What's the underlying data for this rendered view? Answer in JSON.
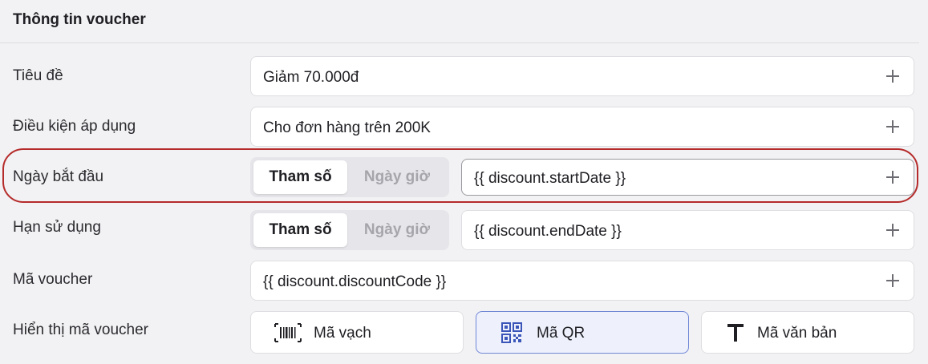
{
  "section": {
    "title": "Thông tin voucher"
  },
  "fields": {
    "title": {
      "label": "Tiêu đề",
      "value": "Giảm 70.000đ",
      "add_icon": "plus-icon"
    },
    "condition": {
      "label": "Điều kiện áp dụng",
      "value": "Cho đơn hàng trên 200K",
      "add_icon": "plus-icon"
    },
    "start_date": {
      "label": "Ngày bắt đầu",
      "toggle": {
        "active": "Tham số",
        "inactive": "Ngày giờ"
      },
      "value": "{{ discount.startDate }}",
      "add_icon": "plus-icon",
      "highlighted": true
    },
    "expiry": {
      "label": "Hạn sử dụng",
      "toggle": {
        "active": "Tham số",
        "inactive": "Ngày giờ"
      },
      "value": "{{ discount.endDate }}",
      "add_icon": "plus-icon"
    },
    "code": {
      "label": "Mã voucher",
      "value": "{{ discount.discountCode }}",
      "add_icon": "plus-icon"
    },
    "display": {
      "label": "Hiển thị mã voucher",
      "options": [
        {
          "label": "Mã vạch",
          "icon": "barcode-icon",
          "selected": false
        },
        {
          "label": "Mã QR",
          "icon": "qr-code-icon",
          "selected": true
        },
        {
          "label": "Mã văn bản",
          "icon": "text-icon",
          "selected": false
        }
      ]
    }
  },
  "colors": {
    "background": "#f2f2f4",
    "field_bg": "#ffffff",
    "highlight_ring": "#b52a2a",
    "selected_border": "#6f86d6",
    "selected_bg": "#eef1fb",
    "inactive_text": "#a5a5ab"
  }
}
